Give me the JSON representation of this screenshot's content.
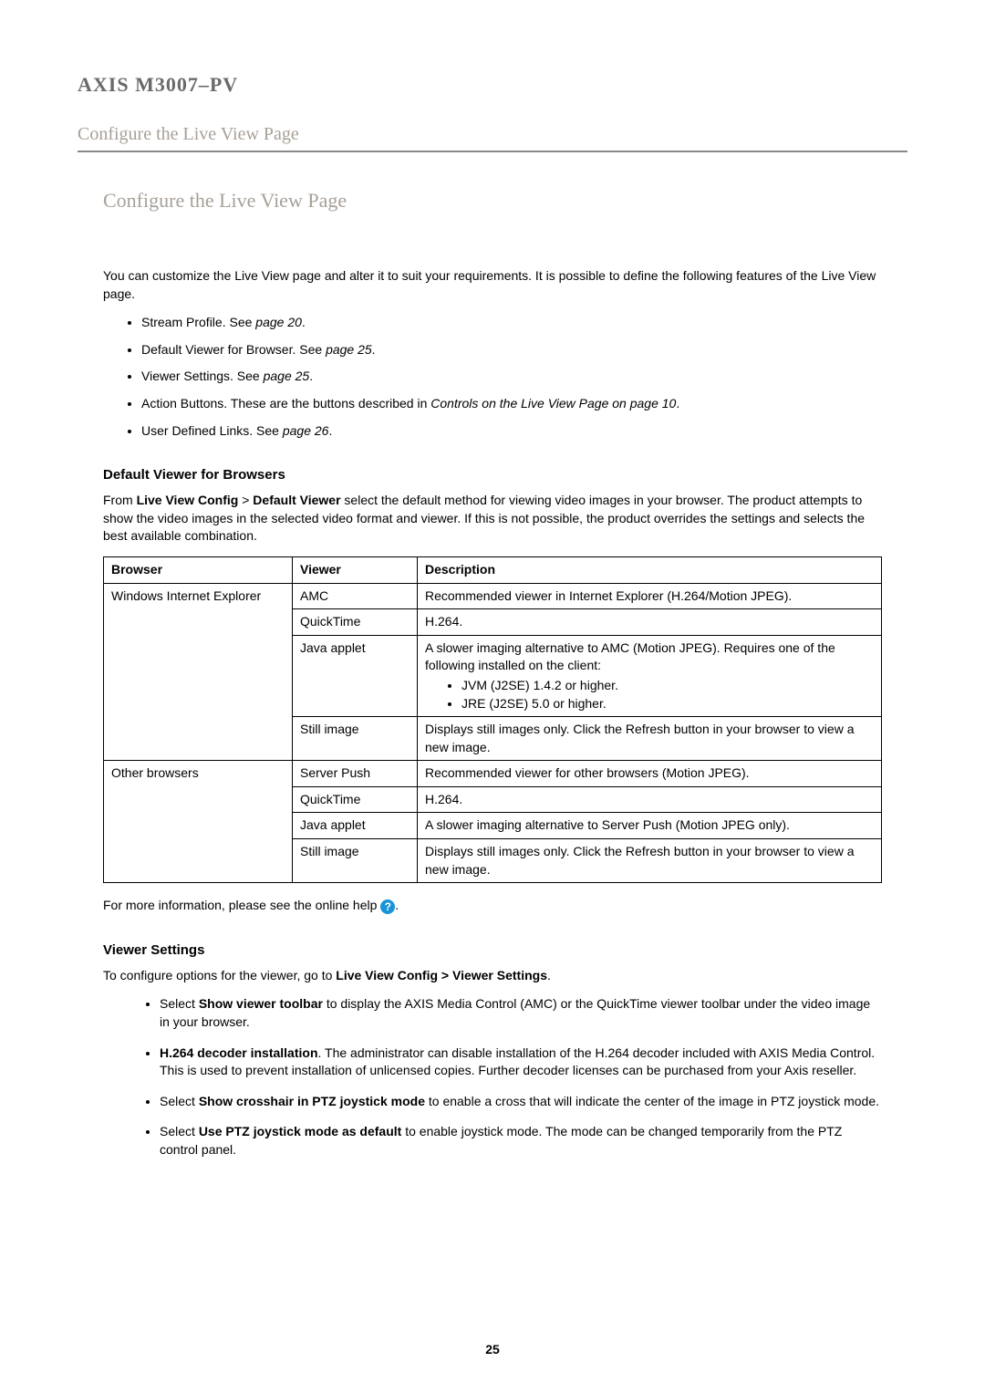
{
  "product_title": "AXIS M3007–PV",
  "section_header": "Configure the Live View Page",
  "page_heading": "Configure the Live View Page",
  "intro": "You can customize the Live View page and alter it to suit your requirements. It is possible to define the following features of the Live View page.",
  "features": {
    "f0_a": "Stream Profile. See ",
    "f0_b": "page 20",
    "f0_c": ".",
    "f1_a": "Default Viewer for Browser. See ",
    "f1_b": "page 25",
    "f1_c": ".",
    "f2_a": "Viewer Settings. See ",
    "f2_b": "page 25",
    "f2_c": ".",
    "f3_a": "Action Buttons. These are the buttons described in ",
    "f3_b": "Controls on the Live View Page on page 10",
    "f3_c": ".",
    "f4_a": "User Defined Links. See ",
    "f4_b": "page 26",
    "f4_c": "."
  },
  "dv_heading": "Default Viewer for Browsers",
  "dv_para_a": "From ",
  "dv_para_b": "Live View Config",
  "dv_para_c": " > ",
  "dv_para_d": "Default Viewer",
  "dv_para_e": " select the default method for viewing video images in your browser. The product attempts to show the video images in the selected video format and viewer. If this is not possible, the product overrides the settings and selects the best available combination.",
  "table": {
    "h_browser": "Browser",
    "h_viewer": "Viewer",
    "h_desc": "Description",
    "browser_ie": "Windows Internet Explorer",
    "browser_other": "Other browsers",
    "v_amc": "AMC",
    "v_qt": "QuickTime",
    "v_java": "Java applet",
    "v_still": "Still image",
    "v_push": "Server Push",
    "d_ie_amc": "Recommended viewer in Internet Explorer (H.264/Motion JPEG).",
    "d_ie_qt": "H.264.",
    "d_ie_java_a": "A slower imaging alternative to AMC (Motion JPEG). Requires one of the following installed on the client:",
    "d_ie_java_b1": "JVM (J2SE) 1.4.2 or higher.",
    "d_ie_java_b2": "JRE (J2SE) 5.0 or higher.",
    "d_ie_still": "Displays still images only. Click the Refresh button in your browser to view a new image.",
    "d_ot_push": "Recommended viewer for other browsers (Motion JPEG).",
    "d_ot_qt": "H.264.",
    "d_ot_java": "A slower imaging alternative to Server Push (Motion JPEG only).",
    "d_ot_still": "Displays still images only. Click the Refresh button in your browser to view a new image."
  },
  "more_info_a": "For more information, please see the online help ",
  "more_info_b": ".",
  "vs_heading": "Viewer Settings",
  "vs_para_a": "To configure options for the viewer, go to ",
  "vs_para_b": "Live View Config > Viewer Settings",
  "vs_para_c": ".",
  "settings": {
    "s0_a": "Select ",
    "s0_b": "Show viewer toolbar",
    "s0_c": " to display the AXIS Media Control (AMC) or the QuickTime viewer toolbar under the video image in your browser.",
    "s1_a": "H.264 decoder installation",
    "s1_b": ". The administrator can disable installation of the H.264 decoder included with AXIS Media Control. This is used to prevent installation of unlicensed copies. Further decoder licenses can be purchased from your Axis reseller.",
    "s2_a": "Select ",
    "s2_b": "Show crosshair in PTZ joystick mode",
    "s2_c": " to enable a cross that will indicate the center of the image in PTZ joystick mode.",
    "s3_a": "Select ",
    "s3_b": "Use PTZ joystick mode as default",
    "s3_c": " to enable joystick mode. The mode can be changed temporarily from the PTZ control panel."
  },
  "page_number": "25"
}
